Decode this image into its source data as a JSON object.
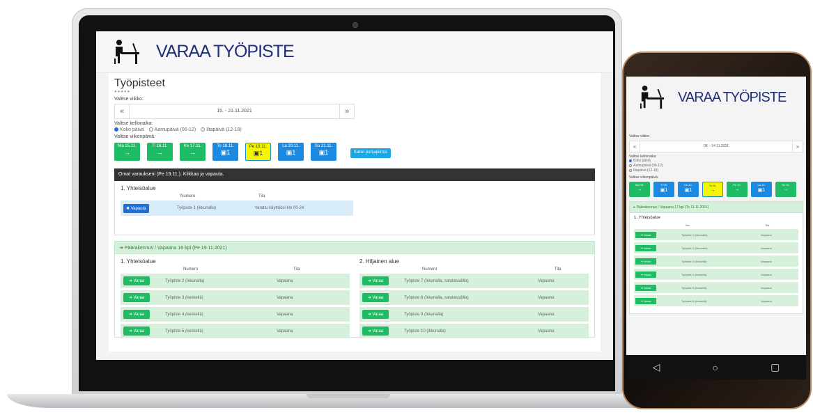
{
  "app": {
    "brand": "VARAA TYÖPISTE"
  },
  "laptop": {
    "page_title": "Työpisteet",
    "week_label": "Valitse viikko:",
    "week_value": "15. - 21.11.2021",
    "prev": "«",
    "next": "»",
    "time_label": "Valitse kellonaika:",
    "time_options": [
      "Koko päivä",
      "Aamupäivä (06-12)",
      "Iltapäivä (12-18)"
    ],
    "day_label": "Valitse viikonpäivä:",
    "days": [
      {
        "label": "Ma 15.11.",
        "icon": "→",
        "color": "green"
      },
      {
        "label": "Ti 16.11.",
        "icon": "→",
        "color": "green"
      },
      {
        "label": "Ke 17.11.",
        "icon": "→",
        "color": "green"
      },
      {
        "label": "To 18.11.",
        "icon": "▣1",
        "color": "blue"
      },
      {
        "label": "Pe 19.11.",
        "icon": "▣1",
        "color": "yellow"
      },
      {
        "label": "La 20.11.",
        "icon": "▣1",
        "color": "blue"
      },
      {
        "label": "Su 21.11.",
        "icon": "▣1",
        "color": "blue"
      }
    ],
    "floorplan_button": "Katso pohjapiirros",
    "my_reservations": "Omat varaukseni (Pe 19.11.). Klikkaa ja vapauta.",
    "my_section": "1. Yhteisöalue",
    "col_numero": "Numero",
    "col_tila": "Tila",
    "release_button": "✖ Vapauta",
    "my_row": {
      "numero": "Työpiste 1 (ikkunalla)",
      "tila": "Varattu käyttöösi klo 00-24"
    },
    "main_building": "➔ Päärakennus / Vapaana 16 kpl (Pe 19.11.2021)",
    "section1": "1. Yhteisöalue",
    "section2": "2. Hiljainen alue",
    "reserve_button": "➔ Varaa",
    "left_rows": [
      {
        "numero": "Työpiste 2 (ikkunalla)",
        "tila": "Vapaana"
      },
      {
        "numero": "Työpiste 3 (keskellä)",
        "tila": "Vapaana"
      },
      {
        "numero": "Työpiste 4 (keskellä)",
        "tila": "Vapaana"
      },
      {
        "numero": "Työpiste 5 (keskellä)",
        "tila": "Vapaana"
      }
    ],
    "right_rows": [
      {
        "numero": "Työpiste 7 (ikkunalla, satulatuolilla)",
        "tila": "Vapaana"
      },
      {
        "numero": "Työpiste 8 (ikkunalla, satulatuolilla)",
        "tila": "Vapaana"
      },
      {
        "numero": "Työpiste 9 (ikkunalla)",
        "tila": "Vapaana"
      },
      {
        "numero": "Työpiste 10 (ikkunalla)",
        "tila": "Vapaana"
      }
    ]
  },
  "phone": {
    "week_label": "Valitse viikko:",
    "week_value": "08. - 14.11.2021",
    "prev": "«",
    "next": "»",
    "time_label": "Valitse kellonaika:",
    "time_options": [
      "Koko päivä",
      "Aamupäivä (06-12)",
      "Iltapäivä (12-18)"
    ],
    "day_label": "Valitse viikonpäivä:",
    "days": [
      {
        "label": "Ma 08.",
        "icon": "→",
        "color": "green"
      },
      {
        "label": "Ti 09.",
        "icon": "▣1",
        "color": "blue"
      },
      {
        "label": "Ke 10.",
        "icon": "▣1",
        "color": "blue"
      },
      {
        "label": "To 11.",
        "icon": "→",
        "color": "yellow"
      },
      {
        "label": "Pe 12.",
        "icon": "→",
        "color": "green"
      },
      {
        "label": "La 13.",
        "icon": "▣1",
        "color": "blue"
      },
      {
        "label": "Su 14.",
        "icon": "→",
        "color": "green"
      }
    ],
    "main_building": "➔ Päärakennus / Vapaana 17 kpl (To 11.11.2021)",
    "section": "1. Yhteisöalue",
    "col_nro": "Nro",
    "col_tila": "Tila",
    "reserve_button": "➔ Varaa",
    "rows": [
      {
        "numero": "Työpiste 1 (ikkunalla)",
        "tila": "Vapaana"
      },
      {
        "numero": "Työpiste 2 (ikkunalla)",
        "tila": "Vapaana"
      },
      {
        "numero": "Työpiste 3 (keskellä)",
        "tila": "Vapaana"
      },
      {
        "numero": "Työpiste 4 (keskellä)",
        "tila": "Vapaana"
      },
      {
        "numero": "Työpiste 5 (keskellä)",
        "tila": "Vapaana"
      },
      {
        "numero": "Työpiste 6 (keskellä)",
        "tila": "Vapaana"
      }
    ],
    "nav": {
      "back": "◁",
      "home": "○",
      "recents": "▢"
    }
  }
}
